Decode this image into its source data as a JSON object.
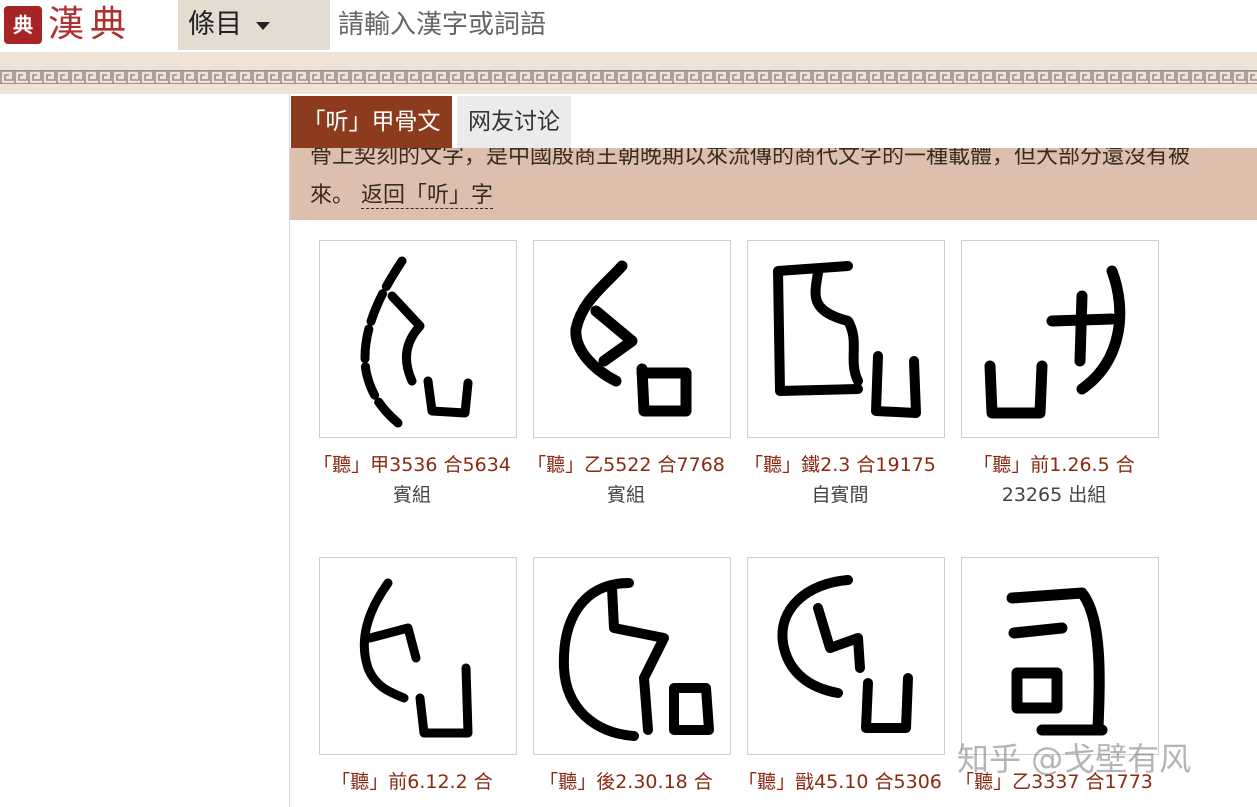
{
  "header": {
    "brand_text": "漢典",
    "seal_text": "典",
    "dropdown_label": "條目",
    "search_placeholder": "請輸入漢字或詞語"
  },
  "tabs": [
    {
      "label": "「听」甲骨文",
      "active": true
    },
    {
      "label": "网友讨论",
      "active": false
    }
  ],
  "banner": {
    "line1": "骨上契刻的文字，是中國殷商王朝晚期以來流傳的商代文字的一種載體，但大部分還沒有被",
    "line2_prefix": "來。",
    "back_link": "返回「听」字"
  },
  "glyphs": [
    {
      "source": "「聽」甲3536 合5634",
      "group": "賓組"
    },
    {
      "source": "「聽」乙5522 合7768",
      "group": "賓組"
    },
    {
      "source": "「聽」鐵2.3 合19175",
      "group": "自賓間"
    },
    {
      "source": "「聽」前1.26.5 合",
      "group": "23265 出組"
    },
    {
      "source": "「聽」前6.12.2 合",
      "group": ""
    },
    {
      "source": "「聽」後2.30.18 合",
      "group": ""
    },
    {
      "source": "「聽」戩45.10 合5306",
      "group": ""
    },
    {
      "source": "「聽」乙3337 合1773",
      "group": ""
    }
  ],
  "watermark": "知乎 @戈壁有风",
  "colors": {
    "accent": "#8c3b1f",
    "banner": "#dcc0ad",
    "caption": "#8a2a12"
  }
}
